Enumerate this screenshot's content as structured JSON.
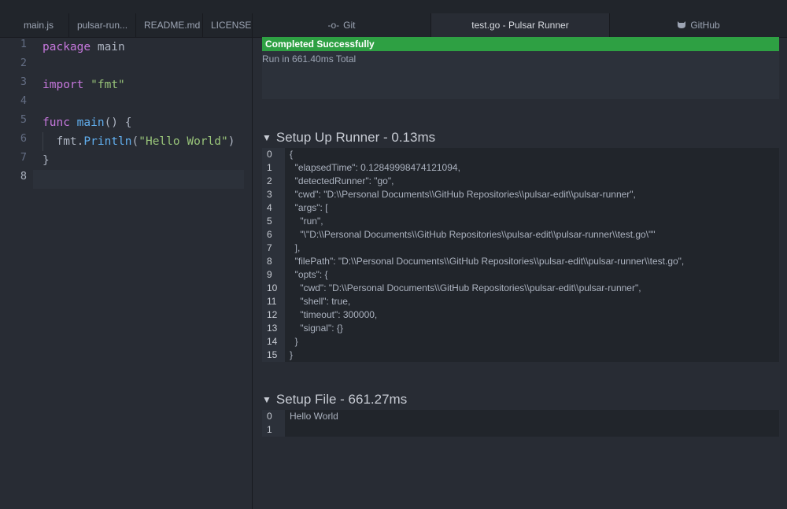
{
  "left_tabs": [
    "main.js",
    "pulsar-run...",
    "README.md",
    "LICENSE.md"
  ],
  "editor": {
    "line_numbers": [
      "1",
      "2",
      "3",
      "4",
      "5",
      "6",
      "7",
      "8"
    ],
    "code": {
      "l1_kw": "package",
      "l1_rest": " main",
      "l3_kw": "import",
      "l3_str": "\"fmt\"",
      "l5_kw": "func",
      "l5_fn": "main",
      "l5_rest": "() {",
      "l6_obj": "fmt.",
      "l6_fn": "Println",
      "l6_paren": "(",
      "l6_str": "\"Hello World\"",
      "l6_close": ")",
      "l7": "}"
    }
  },
  "right_tabs": {
    "git": "Git",
    "git_icon": "git-commit-icon",
    "active": "test.go - Pulsar Runner",
    "github": "GitHub",
    "github_icon": "octocat-icon"
  },
  "status": {
    "badge": "Completed Successfully",
    "runtime": "Run in 661.40ms Total"
  },
  "sections": [
    {
      "title": "Setup Up Runner - 0.13ms",
      "rows": [
        {
          "n": "0",
          "t": "{"
        },
        {
          "n": "1",
          "t": "  \"elapsedTime\": 0.12849998474121094,"
        },
        {
          "n": "2",
          "t": "  \"detectedRunner\": \"go\","
        },
        {
          "n": "3",
          "t": "  \"cwd\": \"D:\\\\Personal Documents\\\\GitHub Repositories\\\\pulsar-edit\\\\pulsar-runner\","
        },
        {
          "n": "4",
          "t": "  \"args\": ["
        },
        {
          "n": "5",
          "t": "    \"run\","
        },
        {
          "n": "6",
          "t": "    \"\\\"D:\\\\Personal Documents\\\\GitHub Repositories\\\\pulsar-edit\\\\pulsar-runner\\\\test.go\\\"\""
        },
        {
          "n": "7",
          "t": "  ],"
        },
        {
          "n": "8",
          "t": "  \"filePath\": \"D:\\\\Personal Documents\\\\GitHub Repositories\\\\pulsar-edit\\\\pulsar-runner\\\\test.go\","
        },
        {
          "n": "9",
          "t": "  \"opts\": {"
        },
        {
          "n": "10",
          "t": "    \"cwd\": \"D:\\\\Personal Documents\\\\GitHub Repositories\\\\pulsar-edit\\\\pulsar-runner\","
        },
        {
          "n": "11",
          "t": "    \"shell\": true,"
        },
        {
          "n": "12",
          "t": "    \"timeout\": 300000,"
        },
        {
          "n": "13",
          "t": "    \"signal\": {}"
        },
        {
          "n": "14",
          "t": "  }"
        },
        {
          "n": "15",
          "t": "}"
        }
      ]
    },
    {
      "title": "Setup File - 661.27ms",
      "rows": [
        {
          "n": "0",
          "t": "Hello World"
        },
        {
          "n": "1",
          "t": ""
        }
      ]
    }
  ],
  "colors": {
    "success": "#2ea043",
    "keyword": "#c678dd",
    "function": "#61afef",
    "string": "#98c379"
  }
}
